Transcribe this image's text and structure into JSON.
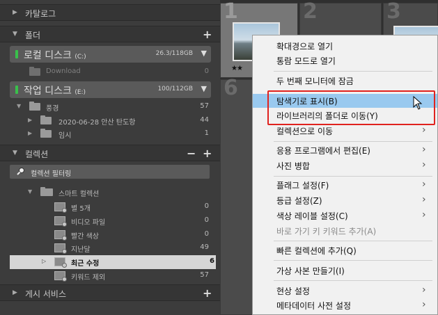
{
  "left_panel": {
    "catalog": {
      "label": "카탈로그"
    },
    "folders": {
      "label": "폴더",
      "disks": [
        {
          "name": "로컬 디스크",
          "letter": "(C:)",
          "size": "26.3/118GB",
          "folders": [
            {
              "name": "Download",
              "count": "0"
            }
          ]
        },
        {
          "name": "작업 디스크",
          "letter": "(E:)",
          "size": "100/112GB",
          "folders": [
            {
              "name": "풍경",
              "count": "57"
            },
            {
              "name": "2020-06-28 안산 탄도항",
              "count": "44"
            },
            {
              "name": "임시",
              "count": "1"
            }
          ]
        }
      ]
    },
    "collections": {
      "label": "컬렉션",
      "filter_placeholder": "컬렉션 필터링",
      "smart_group": "스마트 컬렉션",
      "items": [
        {
          "name": "별 5개",
          "count": "0"
        },
        {
          "name": "비디오 파일",
          "count": "0"
        },
        {
          "name": "빨간 색상",
          "count": "0"
        },
        {
          "name": "지난달",
          "count": "49"
        },
        {
          "name": "최근 수정",
          "count": "6",
          "selected": true
        },
        {
          "name": "키워드 제외",
          "count": "57"
        }
      ]
    },
    "publish": {
      "label": "게시 서비스"
    }
  },
  "grid": {
    "cell_numbers": [
      "1",
      "2",
      "3",
      "6"
    ],
    "rating": "★★"
  },
  "context_menu": {
    "items": [
      {
        "label": "확대경으로 열기",
        "submenu": false,
        "disabled": false
      },
      {
        "label": "통람 모드로 열기",
        "submenu": false,
        "disabled": false
      },
      {
        "label": "두 번째 모니터에 잠금",
        "submenu": false,
        "disabled": false
      },
      {
        "label": "탐색기로 표시(B)",
        "submenu": false,
        "disabled": false,
        "highlighted": true
      },
      {
        "label": "라이브러리의 폴더로 이동(Y)",
        "submenu": false,
        "disabled": false
      },
      {
        "label": "컬렉션으로 이동",
        "submenu": true,
        "disabled": false
      },
      {
        "label": "응용 프로그램에서 편집(E)",
        "submenu": true,
        "disabled": false
      },
      {
        "label": "사진 병합",
        "submenu": true,
        "disabled": false
      },
      {
        "label": "플래그 설정(F)",
        "submenu": true,
        "disabled": false
      },
      {
        "label": "등급 설정(Z)",
        "submenu": true,
        "disabled": false
      },
      {
        "label": "색상 레이블 설정(C)",
        "submenu": true,
        "disabled": false
      },
      {
        "label": "바로 가기 키 키워드 추가(A)",
        "submenu": false,
        "disabled": true
      },
      {
        "label": "빠른 컬렉션에 추가(Q)",
        "submenu": false,
        "disabled": false
      },
      {
        "label": "가상 사본 만들기(I)",
        "submenu": false,
        "disabled": false
      },
      {
        "label": "현상 설정",
        "submenu": true,
        "disabled": false
      },
      {
        "label": "메타데이터 사전 설정",
        "submenu": true,
        "disabled": false
      }
    ],
    "arrow_glyph": "›"
  },
  "colors": {
    "highlight": "#99c9ef",
    "annotation": "#e0221e",
    "selected_row": "#d6d6d6",
    "disk_led": "#39c04b"
  }
}
